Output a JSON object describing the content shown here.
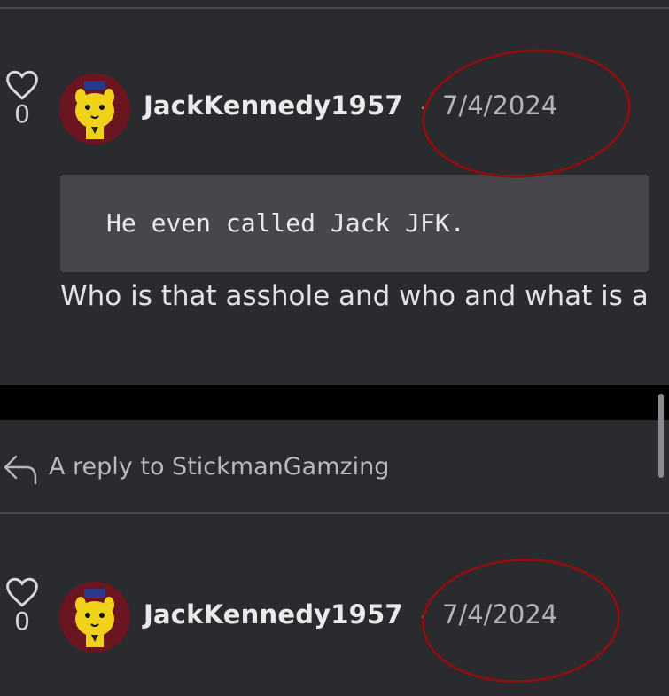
{
  "comments": [
    {
      "likes": "0",
      "username": "JackKennedy1957",
      "separator": "·",
      "date": "7/4/2024",
      "quote": "He even called Jack JFK.",
      "text": "Who is that asshole and who and what is a"
    },
    {
      "likes": "0",
      "username": "JackKennedy1957",
      "separator": "·",
      "date": "7/4/2024"
    }
  ],
  "reply_label": "A reply to StickmanGamzing",
  "colors": {
    "background": "#2a2b2f",
    "quote_bg": "#46474b",
    "avatar_bg": "#6b1520",
    "annotation_red": "#8a0f0f"
  }
}
